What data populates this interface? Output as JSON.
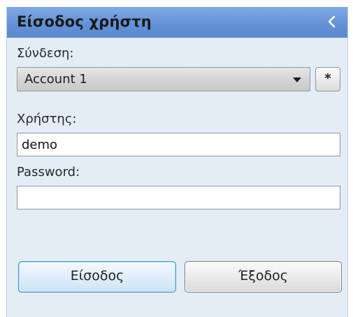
{
  "panel": {
    "title": "Είσοδος χρήστη",
    "collapse_icon": "chevron-left-icon"
  },
  "connection": {
    "label": "Σύνδεση:",
    "selected": "Account 1",
    "extra_button_label": "*"
  },
  "user": {
    "label": "Χρήστης:",
    "value": "demo"
  },
  "password": {
    "label": "Password:",
    "value": ""
  },
  "buttons": {
    "login_label": "Είσοδος",
    "exit_label": "Έξοδος"
  },
  "colors": {
    "header": "#6492d6",
    "panel_bg": "#e4ecf6",
    "login_border": "#3f8fcb"
  }
}
